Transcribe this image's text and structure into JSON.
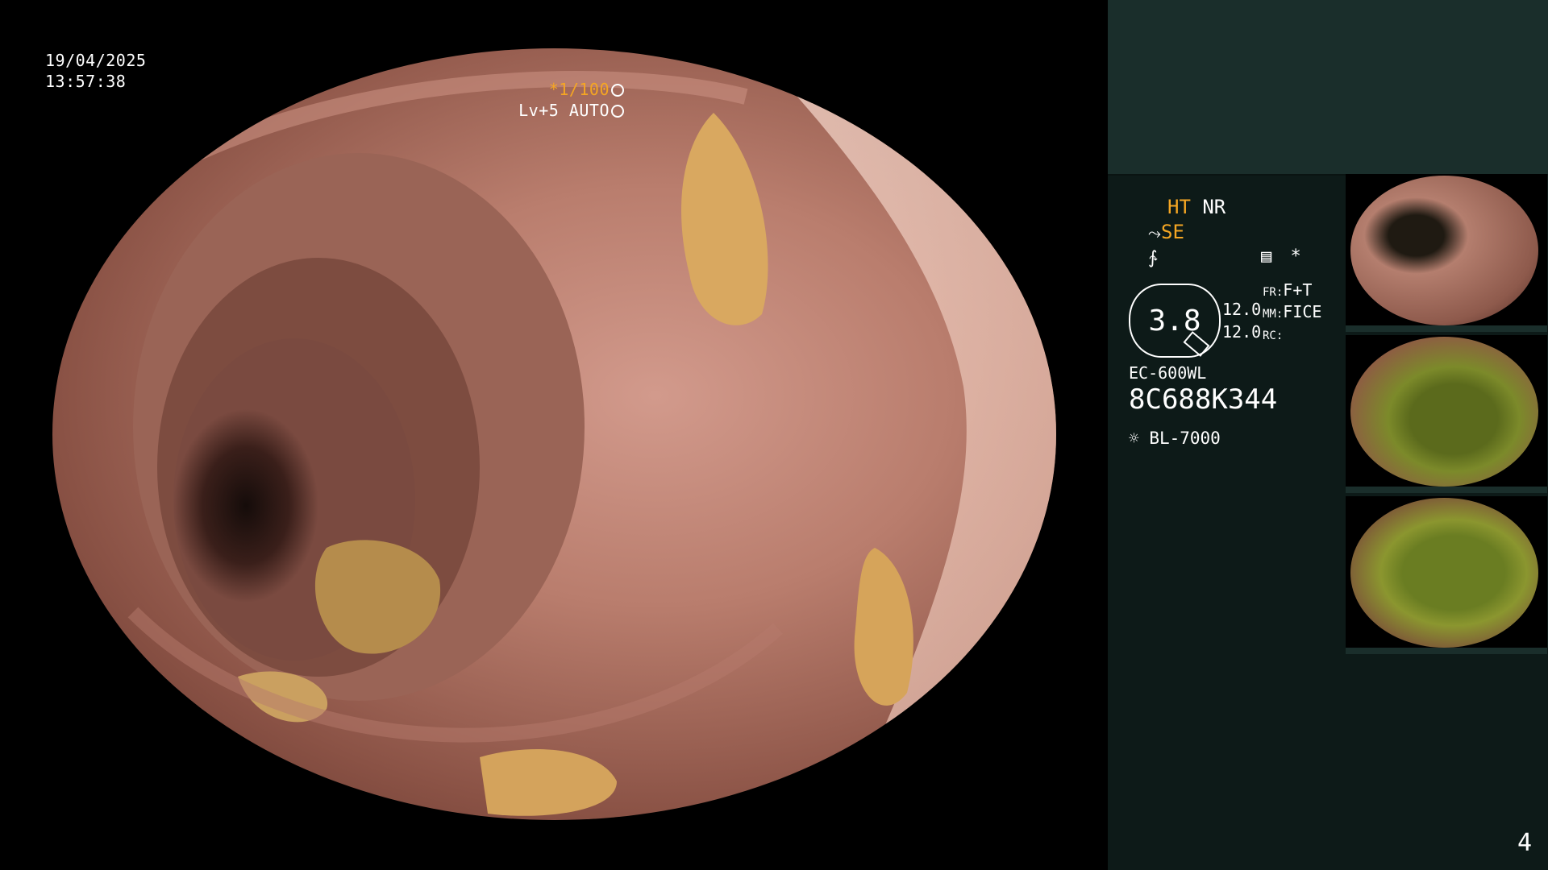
{
  "osd": {
    "date": "19/04/2025",
    "time": "13:57:38",
    "shutter": "*1/100",
    "iris": "Lv+5 AUTO"
  },
  "panel": {
    "mode_ht": "HT",
    "mode_nr": "NR",
    "mode_se": "SE",
    "zoom_ratio": "3.8",
    "val_1": "12.0",
    "val_2": "12.0",
    "fr_label": "FR:",
    "fr_value": "F+T",
    "mm_label": "MM:",
    "mm_value": "FICE",
    "rc_label": "RC:",
    "scope_model": "EC-600WL",
    "scope_serial": "8C688K344",
    "light_source": "BL-7000",
    "page_number": "4"
  },
  "colors": {
    "accent_orange": "#f5a623",
    "panel_bg": "#0d1a18",
    "panel_top_bg": "#1a2e2b"
  },
  "icons": [
    "curve-icon",
    "enhance-icon",
    "settings-icon",
    "asterisk-icon",
    "light-icon",
    "iris-icon",
    "shutter-icon"
  ]
}
